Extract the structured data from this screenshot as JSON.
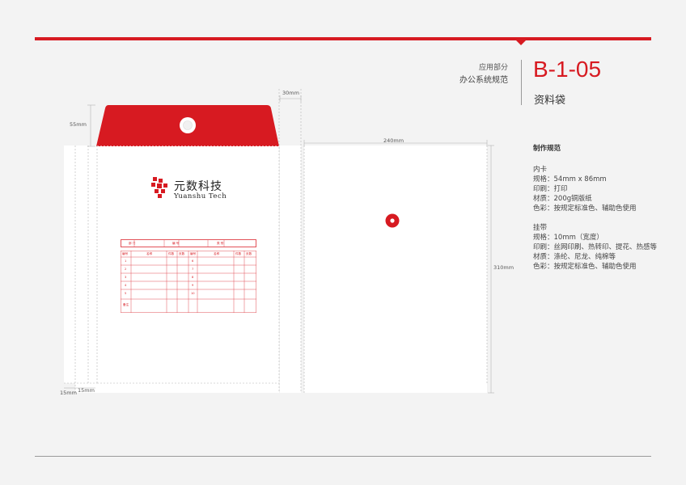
{
  "header": {
    "section": "应用部分",
    "subsection": "办公系统规范",
    "code": "B-1-05",
    "title": "资料袋"
  },
  "spec": {
    "heading": "制作规范",
    "groups": [
      {
        "title": "内卡",
        "rows": [
          "规格：54mm x 86mm",
          "印刷：打印",
          "材质：200g铜版纸",
          "色彩：按规定标准色、辅助色使用"
        ]
      },
      {
        "title": "挂带",
        "rows": [
          "规格：10mm（宽度）",
          "印刷：丝网印刷、热转印、提花、热感等",
          "材质：涤纶、尼龙、纯棉等",
          "色彩：按规定标准色、辅助色使用"
        ]
      }
    ]
  },
  "dimensions": {
    "flap_height": "55mm",
    "spine_width": "30mm",
    "panel_width": "240mm",
    "panel_height": "310mm",
    "side_left": "15mm",
    "side_right": "15mm"
  },
  "logo": {
    "name_cn": "元数科技",
    "name_en": "Yuanshu Tech"
  },
  "form": {
    "header_cells": [
      "部 门",
      "编 号",
      "类 别"
    ],
    "left_col_headers": [
      "编号",
      "名称",
      "件数",
      "页数"
    ],
    "right_col_headers": [
      "编号",
      "名称",
      "件数",
      "页数"
    ],
    "left_row_numbers": [
      "1",
      "2",
      "3",
      "4",
      "5",
      "备注"
    ],
    "right_row_numbers": [
      "6",
      "7",
      "8",
      "9",
      "10"
    ]
  },
  "colors": {
    "brand_red": "#d71a21",
    "paper": "#ffffff",
    "background": "#f3f3f3"
  }
}
